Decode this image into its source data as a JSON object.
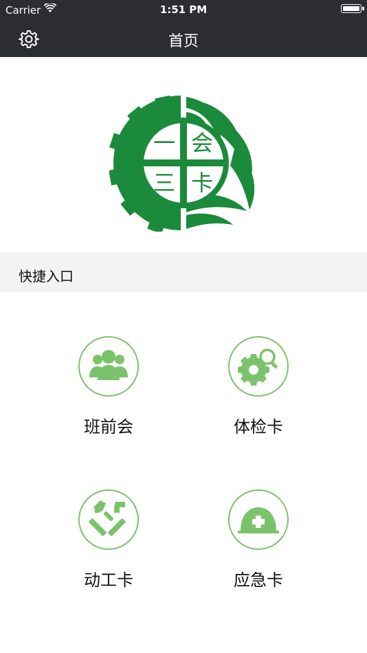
{
  "status_bar": {
    "carrier": "Carrier",
    "time": "1:51 PM"
  },
  "nav": {
    "title": "首页",
    "settings_icon": "gear-icon"
  },
  "logo": {
    "text_top_left": "一",
    "text_top_right": "会",
    "text_bottom_left": "三",
    "text_bottom_right": "卡",
    "color": "#1b8a3a"
  },
  "section": {
    "title": "快捷入口"
  },
  "quick_entries": [
    {
      "label": "班前会",
      "icon": "users-icon"
    },
    {
      "label": "体检卡",
      "icon": "gear-search-icon"
    },
    {
      "label": "动工卡",
      "icon": "tools-icon"
    },
    {
      "label": "应急卡",
      "icon": "safety-helmet-icon"
    }
  ],
  "colors": {
    "nav_bg": "#2b2d33",
    "accent": "#7bc36a",
    "section_bg": "#f3f3f3"
  }
}
